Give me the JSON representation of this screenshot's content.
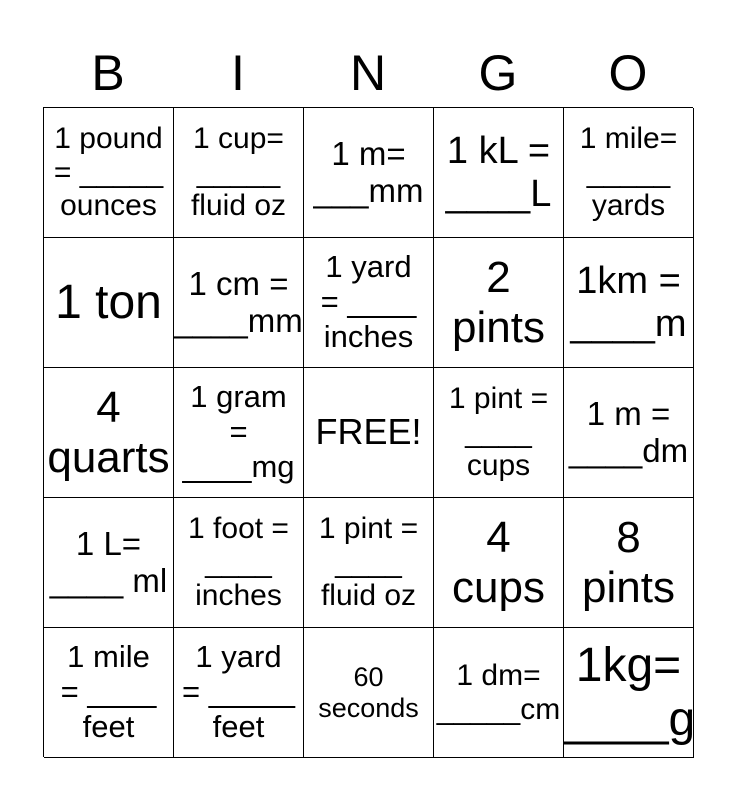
{
  "header": [
    "B",
    "I",
    "N",
    "G",
    "O"
  ],
  "rows": [
    [
      {
        "lines": [
          "1 pound",
          "= _____",
          "ounces"
        ]
      },
      {
        "lines": [
          "1 cup=",
          "_____",
          "fluid oz"
        ]
      },
      {
        "lines": [
          "1 m=",
          "___mm"
        ]
      },
      {
        "lines": [
          "1 kL =",
          "____L"
        ]
      },
      {
        "lines": [
          "1 mile=",
          "_____",
          "yards"
        ]
      }
    ],
    [
      {
        "lines": [
          "1 ton"
        ]
      },
      {
        "lines": [
          "1 cm =",
          "____mm"
        ]
      },
      {
        "lines": [
          "1 yard",
          "= ____",
          "inches"
        ]
      },
      {
        "lines": [
          "2",
          "pints"
        ]
      },
      {
        "lines": [
          "1km =",
          "____m"
        ]
      }
    ],
    [
      {
        "lines": [
          "4",
          "quarts"
        ]
      },
      {
        "lines": [
          "1 gram",
          "=",
          "____mg"
        ]
      },
      {
        "lines": [
          "FREE!"
        ]
      },
      {
        "lines": [
          "1 pint =",
          "____",
          "cups"
        ]
      },
      {
        "lines": [
          "1 m =",
          "____dm"
        ]
      }
    ],
    [
      {
        "lines": [
          "1 L=",
          "____ ml"
        ]
      },
      {
        "lines": [
          "1 foot =",
          "____",
          "inches"
        ]
      },
      {
        "lines": [
          "1 pint =",
          "____",
          "fluid oz"
        ]
      },
      {
        "lines": [
          "4",
          "cups"
        ]
      },
      {
        "lines": [
          "8",
          "pints"
        ]
      }
    ],
    [
      {
        "lines": [
          "1 mile",
          "= ____",
          "feet"
        ]
      },
      {
        "lines": [
          "1 yard",
          "= _____",
          "feet"
        ]
      },
      {
        "lines": [
          "60",
          "seconds"
        ]
      },
      {
        "lines": [
          "1 dm=",
          "_____cm"
        ]
      },
      {
        "lines": [
          "1kg=",
          "____g"
        ]
      }
    ]
  ]
}
